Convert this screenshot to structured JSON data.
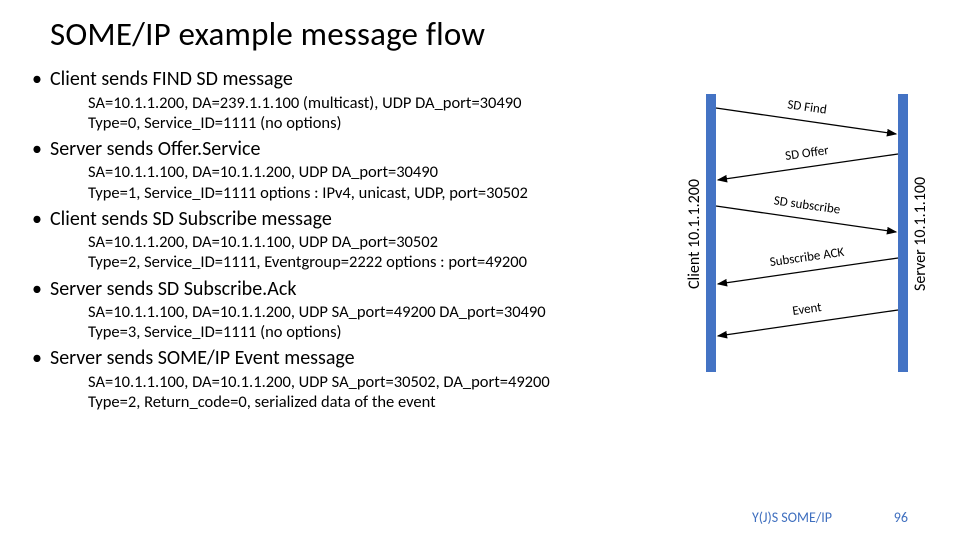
{
  "title": "SOME/IP example message flow",
  "bullets": [
    {
      "heading": "Client sends FIND SD message",
      "sub": "SA=10.1.1.200, DA=239.1.1.100 (multicast), UDP DA_port=30490\nType=0, Service_ID=1111 (no options)"
    },
    {
      "heading": "Server sends Offer.Service",
      "sub": "SA=10.1.1.100, DA=10.1.1.200, UDP DA_port=30490\nType=1, Service_ID=1111   options : IPv4, unicast, UDP, port=30502"
    },
    {
      "heading": "Client sends SD Subscribe message",
      "sub": "SA=10.1.1.200, DA=10.1.1.100, UDP DA_port=30502\nType=2, Service_ID=1111, Eventgroup=2222  options : port=49200"
    },
    {
      "heading": "Server sends SD Subscribe.Ack",
      "sub": "SA=10.1.1.100, DA=10.1.1.200, UDP SA_port=49200 DA_port=30490\nType=3, Service_ID=1111 (no options)"
    },
    {
      "heading": "Server sends SOME/IP Event message",
      "sub": "SA=10.1.1.100, DA=10.1.1.200, UDP SA_port=30502, DA_port=49200\nType=2, Return_code=0, serialized data of the event"
    }
  ],
  "diagram": {
    "client_label": "Client 10.1.1.200",
    "server_label": "Server 10.1.1.100",
    "arrows": [
      {
        "label": "SD Find",
        "dir": "right"
      },
      {
        "label": "SD Offer",
        "dir": "left"
      },
      {
        "label": "SD subscribe",
        "dir": "right"
      },
      {
        "label": "Subscribe ACK",
        "dir": "left"
      },
      {
        "label": "Event",
        "dir": "left"
      }
    ]
  },
  "footer": {
    "left": "Y(J)S  SOME/IP",
    "page": "96"
  }
}
